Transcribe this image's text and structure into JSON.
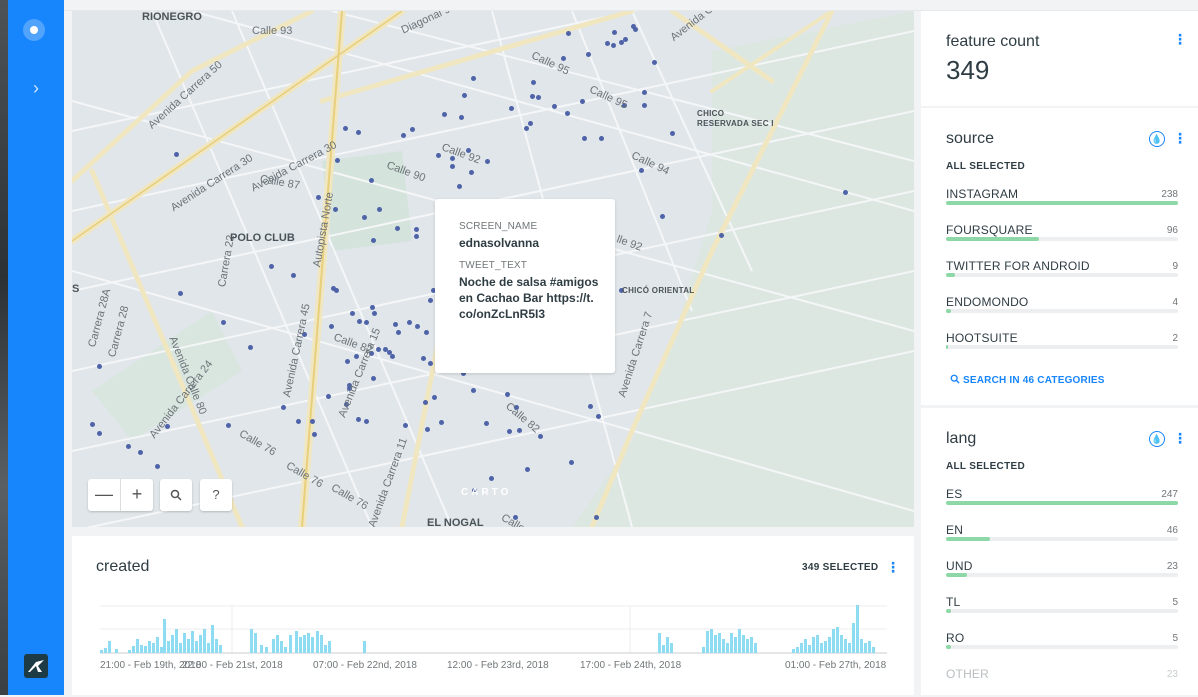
{
  "map": {
    "street_labels": [
      {
        "text": "Calle 93"
      },
      {
        "text": "Calle 95"
      },
      {
        "text": "Calle 95"
      },
      {
        "text": "Avenida Calle 100"
      },
      {
        "text": "Diagonal 93"
      },
      {
        "text": "Avenida Carrera 50"
      },
      {
        "text": "Avenida Carrera 30"
      },
      {
        "text": "Avenida Carrera 30"
      },
      {
        "text": "Avenida Carrera 45"
      },
      {
        "text": "Avenida Calle 80"
      },
      {
        "text": "Avenida Carrera 24"
      },
      {
        "text": "Calle 92"
      },
      {
        "text": "Calle 94"
      },
      {
        "text": "Calle 90"
      },
      {
        "text": "Calle 87"
      },
      {
        "text": "Calle 82"
      },
      {
        "text": "Autopista Norte"
      },
      {
        "text": "Avenida Carrera 15"
      },
      {
        "text": "Avenida Carrera 7"
      },
      {
        "text": "Calle 76"
      },
      {
        "text": "Calle 76"
      },
      {
        "text": "Calle 76"
      },
      {
        "text": "Avenida Carrera 11"
      },
      {
        "text": "Calle 82"
      },
      {
        "text": "Carrera 22"
      },
      {
        "text": "Carrera 28A"
      },
      {
        "text": "Carrera 28"
      },
      {
        "text": "Calle 79"
      },
      {
        "text": "lle 92"
      }
    ],
    "place_labels": [
      {
        "text": "POLO CLUB"
      },
      {
        "text": "EL NOGAL"
      },
      {
        "text": "CHICÓ ORIENTAL"
      },
      {
        "text": "CHICO"
      },
      {
        "text": "RESERVADA SEC I"
      },
      {
        "text": "RIONEGRO"
      },
      {
        "text": "S"
      }
    ],
    "tooltip": {
      "key1": "SCREEN_NAME",
      "val1": "ednasolvanna",
      "key2": "TWEET_TEXT",
      "val2": "Noche de salsa #amigos en Cachao Bar https://t.co/onZcLnR5I3"
    },
    "controls": {
      "zoom_out": "—",
      "zoom_in": "+",
      "search": "🔍",
      "help": "?"
    },
    "attribution": "CARTO"
  },
  "histogram": {
    "title": "created",
    "selected_label": "349 SELECTED",
    "ticks": [
      "21:00 - Feb 19th, 2018",
      "22:00 - Feb 21st, 2018",
      "07:00 - Feb 22nd, 2018",
      "12:00 - Feb 23rd, 2018",
      "17:00 - Feb 24th, 2018",
      "01:00 - Feb 27th, 2018"
    ]
  },
  "widgets": {
    "feature_count": {
      "title": "feature count",
      "value": "349"
    },
    "source": {
      "title": "source",
      "all_selected": "ALL SELECTED",
      "items": [
        {
          "name": "INSTAGRAM",
          "count": "238",
          "fraction": 1.0
        },
        {
          "name": "FOURSQUARE",
          "count": "96",
          "fraction": 0.4
        },
        {
          "name": "TWITTER FOR ANDROID",
          "count": "9",
          "fraction": 0.04
        },
        {
          "name": "ENDOMONDO",
          "count": "4",
          "fraction": 0.02
        },
        {
          "name": "HOOTSUITE",
          "count": "2",
          "fraction": 0.01
        }
      ],
      "search_label": "SEARCH IN 46 CATEGORIES"
    },
    "lang": {
      "title": "lang",
      "all_selected": "ALL SELECTED",
      "items": [
        {
          "name": "ES",
          "count": "247",
          "fraction": 1.0
        },
        {
          "name": "EN",
          "count": "46",
          "fraction": 0.19
        },
        {
          "name": "UND",
          "count": "23",
          "fraction": 0.09
        },
        {
          "name": "TL",
          "count": "5",
          "fraction": 0.02
        },
        {
          "name": "RO",
          "count": "5",
          "fraction": 0.02
        },
        {
          "name": "OTHER",
          "count": "23",
          "fraction": 0.0
        }
      ]
    }
  },
  "colors": {
    "nav": "#1785fb",
    "accent": "#1785fb",
    "bar_fill": "#8dd8a6",
    "point": "#4e63a8",
    "histogram_bar": "#8ddcf2"
  }
}
